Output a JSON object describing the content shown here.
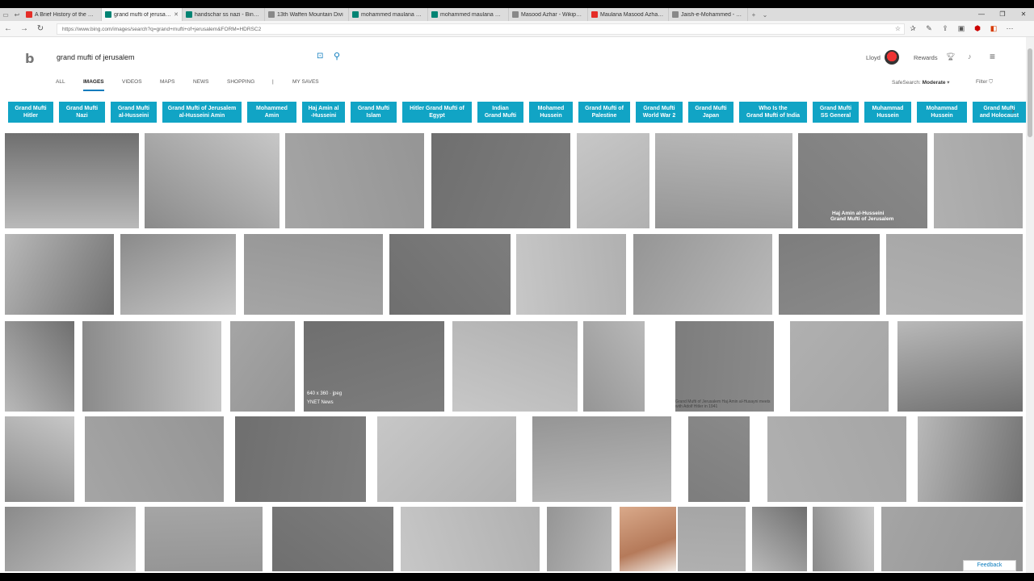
{
  "browser": {
    "tabs": [
      {
        "title": "A Brief History of the Quran",
        "icon": "youtube-icon",
        "color": "#e52d27",
        "active": false
      },
      {
        "title": "grand mufti of jerusalem",
        "icon": "bing-icon",
        "color": "#008373",
        "active": true
      },
      {
        "title": "handschar ss nazi - Bing imag",
        "icon": "bing-icon",
        "color": "#008373",
        "active": false
      },
      {
        "title": "13th Waffen Mountain Divi",
        "icon": "wikipedia-icon",
        "color": "#888888",
        "active": false
      },
      {
        "title": "mohammed maulana maso",
        "icon": "bing-icon",
        "color": "#008373",
        "active": false
      },
      {
        "title": "mohammed maulana maso",
        "icon": "bing-icon",
        "color": "#008373",
        "active": false
      },
      {
        "title": "Masood Azhar - Wikipedia",
        "icon": "wikipedia-icon",
        "color": "#888888",
        "active": false
      },
      {
        "title": "Maulana Masood Azhar, Ch",
        "icon": "youtube-icon",
        "color": "#e52d27",
        "active": false
      },
      {
        "title": "Jaish-e-Mohammed - Wikip",
        "icon": "wikipedia-icon",
        "color": "#888888",
        "active": false
      }
    ],
    "url": "https://www.bing.com/images/search?q=grand+mufti+of+jerusalem&FORM=HDRSC2"
  },
  "header": {
    "logo": "b",
    "query": "grand mufti of jerusalem",
    "user": "Lloyd",
    "rewards": "Rewards"
  },
  "nav": {
    "all": "ALL",
    "images": "IMAGES",
    "videos": "VIDEOS",
    "maps": "MAPS",
    "news": "NEWS",
    "shopping": "SHOPPING",
    "sep": "|",
    "mysaves": "MY SAVES",
    "safesearch_label": "SafeSearch:",
    "safesearch_value": "Moderate",
    "filter": "Filter"
  },
  "related": [
    {
      "l1": "Grand Mufti",
      "l2": "Hitler"
    },
    {
      "l1": "Grand Mufti",
      "l2": "Nazi"
    },
    {
      "l1": "Grand Mufti",
      "l2": "al-Husseini"
    },
    {
      "l1": "Grand Mufti of Jerusalem",
      "l2": "al-Husseini Amin"
    },
    {
      "l1": "Mohammed",
      "l2": "Amin"
    },
    {
      "l1": "Haj Amin al",
      "l2": "-Husseini"
    },
    {
      "l1": "Grand Mufti",
      "l2": "Islam"
    },
    {
      "l1": "Hitler Grand Mufti of",
      "l2": "Egypt"
    },
    {
      "l1": "Indian",
      "l2": "Grand Mufti"
    },
    {
      "l1": "Mohamed",
      "l2": "Hussein"
    },
    {
      "l1": "Grand Mufti of",
      "l2": "Palestine"
    },
    {
      "l1": "Grand Mufti",
      "l2": "World War 2"
    },
    {
      "l1": "Grand Mufti",
      "l2": "Japan"
    },
    {
      "l1": "Who Is the",
      "l2": "Grand Mufti of India"
    },
    {
      "l1": "Grand Mufti",
      "l2": "SS General"
    },
    {
      "l1": "Muhammad",
      "l2": "Hussein"
    },
    {
      "l1": "Mohammad",
      "l2": "Hussein"
    },
    {
      "l1": "Grand Mufti",
      "l2": "and Holocaust"
    }
  ],
  "results": {
    "overlay_size": "640 x 360 · jpeg",
    "overlay_source": "YNET News",
    "caption_1": "Haj Amin al-Husseini",
    "caption_2": "Grand Mufti of Jerusalem",
    "small_caption": "Grand Mufti of Jerusalem Haj Amin al-Husayni meets with Adolf Hitler in 1941"
  },
  "feedback": "Feedback",
  "colors": {
    "accent": "#0a7bbd",
    "related_bg": "#11a4c5"
  }
}
